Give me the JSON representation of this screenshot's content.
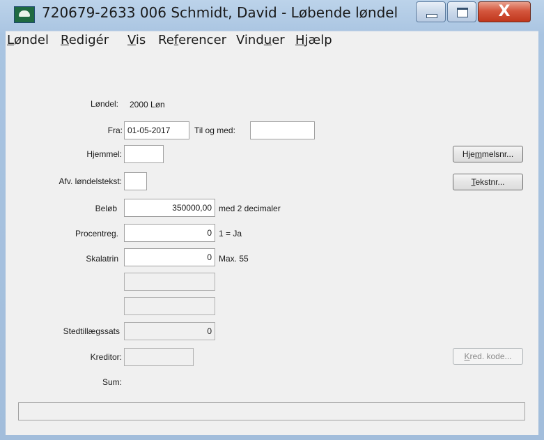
{
  "window": {
    "title": "720679-2633 006 Schmidt, David - Løbende løndel",
    "close_glyph": "X",
    "app_icon": "app-logo-icon"
  },
  "menu": [
    {
      "label": "Løndel",
      "mnemonic_index": 0
    },
    {
      "label": "Redigér",
      "mnemonic_index": 0
    },
    {
      "label": "Vis",
      "mnemonic_index": 0
    },
    {
      "label": "Referencer",
      "mnemonic_index": 2
    },
    {
      "label": "Vinduer",
      "mnemonic_index": 4
    },
    {
      "label": "Hjælp",
      "mnemonic_index": 0
    }
  ],
  "form": {
    "londel_label": "Løndel:",
    "londel_value": "2000  Løn",
    "fra_label": "Fra:",
    "fra_value": "01-05-2017",
    "til_label": "Til og med:",
    "til_value": "",
    "hjemmel_label": "Hjemmel:",
    "hjemmel_value": "",
    "afv_label": "Afv. løndelstekst:",
    "afv_value": "",
    "belob_label": "Beløb",
    "belob_value": "350000,00",
    "belob_hint": "med 2 decimaler",
    "procent_label": "Procentreg.",
    "procent_value": "0",
    "procent_hint": "1 = Ja",
    "skala_label": "Skalatrin",
    "skala_value": "0",
    "skala_hint": "Max. 55",
    "blank1_value": "",
    "blank2_value": "",
    "stedtillaeg_label": "Stedtillægssats",
    "stedtillaeg_value": "0",
    "kreditor_label": "Kreditor:",
    "kreditor_value": "",
    "sum_label": "Sum:"
  },
  "buttons": {
    "hjemmelsnr": {
      "label": "Hjemmelsnr...",
      "mnemonic_index": 3
    },
    "tekstnr": {
      "label": "Tekstnr...",
      "mnemonic_index": 0
    },
    "kred_kode": {
      "label": "Kred. kode...",
      "mnemonic_index": 0
    }
  },
  "status": {
    "text": ""
  }
}
